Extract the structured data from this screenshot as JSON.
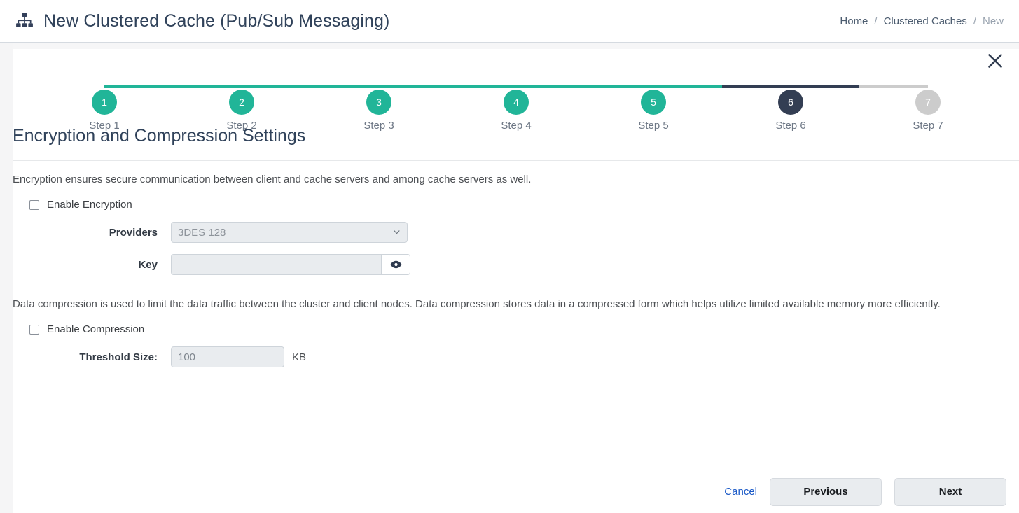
{
  "header": {
    "icon": "sitemap-icon",
    "title": "New Clustered Cache (Pub/Sub Messaging)",
    "breadcrumb": {
      "items": [
        "Home",
        "Clustered Caches",
        "New"
      ],
      "separator": "/"
    },
    "close_icon": "close-icon"
  },
  "stepper": {
    "steps": [
      {
        "number": "1",
        "label": "Step 1",
        "state": "done"
      },
      {
        "number": "2",
        "label": "Step 2",
        "state": "done"
      },
      {
        "number": "3",
        "label": "Step 3",
        "state": "done"
      },
      {
        "number": "4",
        "label": "Step 4",
        "state": "done"
      },
      {
        "number": "5",
        "label": "Step 5",
        "state": "done"
      },
      {
        "number": "6",
        "label": "Step 6",
        "state": "active"
      },
      {
        "number": "7",
        "label": "Step 7",
        "state": "todo"
      }
    ],
    "colors": {
      "done": "#21b598",
      "active": "#333e53",
      "todo": "#cccccc"
    }
  },
  "section": {
    "title": "Encryption and Compression Settings"
  },
  "encryption": {
    "description": "Encryption ensures secure communication between client and cache servers and among cache servers as well.",
    "enable_label": "Enable Encryption",
    "enable_checked": false,
    "providers_label": "Providers",
    "providers_value": "3DES 128",
    "providers_options": [
      "3DES 128"
    ],
    "key_label": "Key",
    "key_value": "",
    "key_placeholder": "",
    "show_key_icon": "eye-icon"
  },
  "compression": {
    "description": "Data compression is used to limit the data traffic between the cluster and client nodes. Data compression stores data in a compressed form which helps utilize limited available memory more efficiently.",
    "enable_label": "Enable Compression",
    "enable_checked": false,
    "threshold_label": "Threshold Size:",
    "threshold_value": "100",
    "threshold_unit": "KB"
  },
  "footer": {
    "cancel_label": "Cancel",
    "previous_label": "Previous",
    "next_label": "Next"
  }
}
